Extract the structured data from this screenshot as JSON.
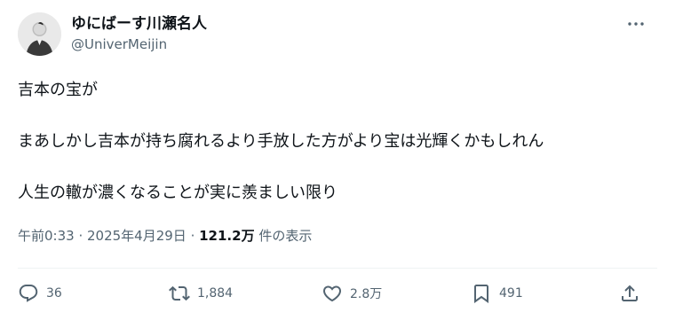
{
  "user": {
    "display_name": "ゆにばーす川瀬名人",
    "handle": "@UniverMeijin"
  },
  "tweet": {
    "line1": "吉本の宝が",
    "line2": "まあしかし吉本が持ち腐れるより手放した方がより宝は光輝くかもしれん",
    "line3": "人生の轍が濃くなることが実に羨ましい限り"
  },
  "meta": {
    "time": "午前0:33",
    "sep1": " · ",
    "date": "2025年4月29日",
    "sep2": " · ",
    "views_count": "121.2万",
    "views_label": " 件の表示"
  },
  "actions": {
    "reply_count": "36",
    "retweet_count": "1,884",
    "like_count": "2.8万",
    "bookmark_count": "491"
  },
  "icons": {
    "more": "more-horizontal-icon",
    "reply": "reply-icon",
    "retweet": "retweet-icon",
    "like": "heart-icon",
    "bookmark": "bookmark-icon",
    "share": "share-icon"
  },
  "colors": {
    "text": "#0f1419",
    "secondary": "#536471",
    "divider": "#eff3f4"
  }
}
